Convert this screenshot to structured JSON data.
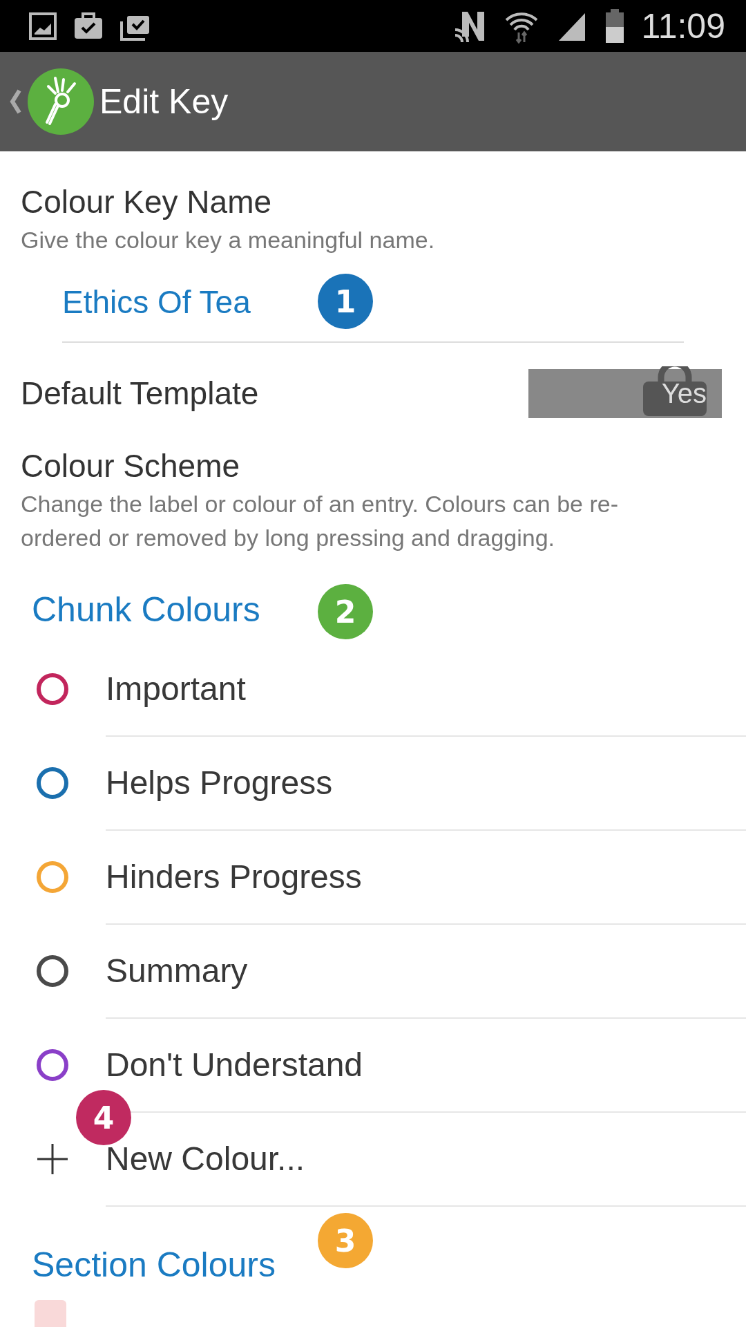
{
  "status_bar": {
    "time": "11:09"
  },
  "app_bar": {
    "title": "Edit Key"
  },
  "name_section": {
    "title": "Colour Key Name",
    "hint": "Give the colour key a meaningful name.",
    "value": "Ethics Of Tea",
    "callout": {
      "number": "1",
      "color": "#1a73b8"
    }
  },
  "default_template": {
    "label": "Default Template",
    "toggle": {
      "text": "Yes",
      "locked": true
    }
  },
  "colour_scheme": {
    "title": "Colour Scheme",
    "description": "Change the label or colour of an entry. Colours can be re-ordered or removed by long pressing and dragging."
  },
  "chunk_colours": {
    "heading": "Chunk Colours",
    "callout": {
      "number": "2",
      "color": "#5cb040"
    },
    "items": [
      {
        "label": "Important",
        "color": "#c2255c"
      },
      {
        "label": "Helps Progress",
        "color": "#1a6fae"
      },
      {
        "label": "Hinders Progress",
        "color": "#f4a636"
      },
      {
        "label": "Summary",
        "color": "#4a4a4a"
      },
      {
        "label": "Don't Understand",
        "color": "#8a3fc8"
      }
    ],
    "add_label": "New Colour...",
    "add_callout": {
      "number": "4",
      "color": "#c02a60"
    }
  },
  "section_colours": {
    "heading": "Section Colours",
    "callout": {
      "number": "3",
      "color": "#f4a833"
    },
    "items": [
      {
        "color": "#f9d9d9"
      }
    ]
  }
}
